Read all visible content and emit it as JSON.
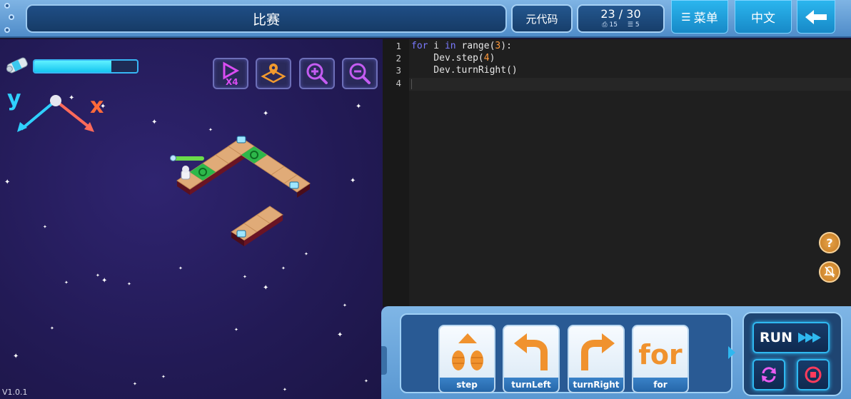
{
  "header": {
    "title": "比赛",
    "meta_code_label": "元代码",
    "score": "23 / 30",
    "stat_a": "15",
    "stat_b": "5",
    "menu_label": "菜单",
    "lang_label": "中文"
  },
  "game": {
    "energy_level": 0.75,
    "axis_y": "y",
    "axis_x": "x",
    "speed_label": "X4",
    "version": "V1.0.1"
  },
  "editor": {
    "line_numbers": [
      "1",
      "2",
      "3",
      "4"
    ],
    "lines": {
      "l1_kw": "for",
      "l1_var": " i ",
      "l1_in": "in",
      "l1_fn": " range(",
      "l1_num": "3",
      "l1_end": "):",
      "l2_pre": "    Dev.",
      "l2_fn": "step(",
      "l2_num": "4",
      "l2_end": ")",
      "l3_pre": "    Dev.",
      "l3_fn": "turnRight()"
    }
  },
  "commands": {
    "items": [
      "step",
      "turnLeft",
      "turnRight",
      "for"
    ],
    "for_glyph": "for",
    "run_label": "RUN"
  },
  "colors": {
    "accent": "#2bb6ee",
    "topbar": "#5f9bd3",
    "game_bg": "#221a55",
    "editor_bg": "#1f1f1f",
    "command_orange": "#f0922e"
  },
  "icons": [
    "energy-canister-icon",
    "speed-x4-icon",
    "map-icon",
    "zoom-in-icon",
    "zoom-out-icon",
    "help-icon",
    "mute-bell-icon",
    "back-arrow-icon",
    "menu-list-icon",
    "fast-forward-icon",
    "reset-icon",
    "stop-icon"
  ]
}
